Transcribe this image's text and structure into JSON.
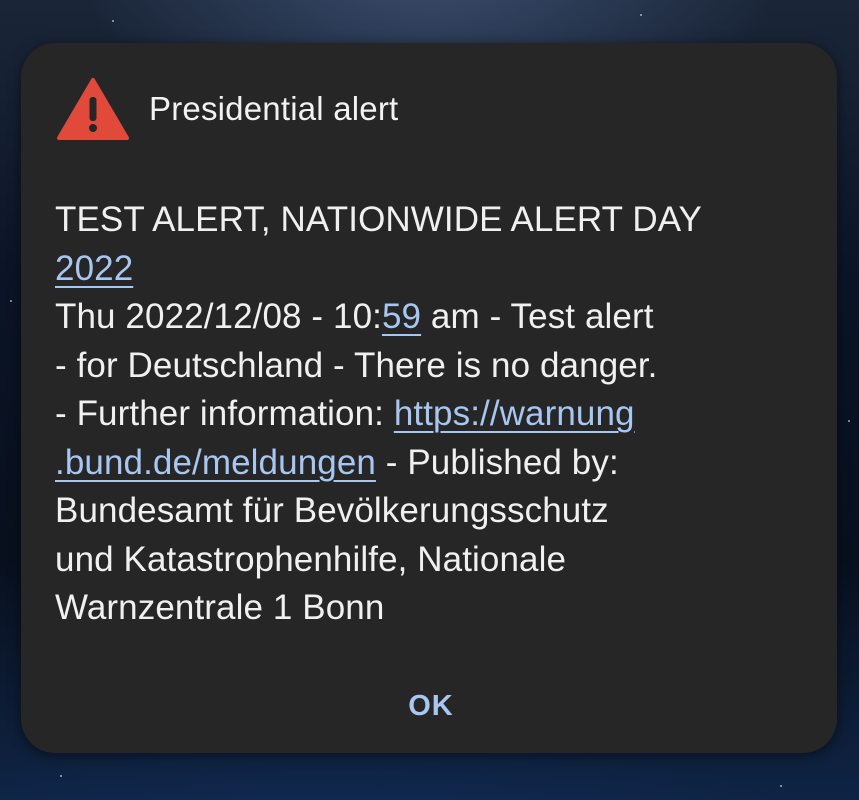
{
  "dialog": {
    "title": "Presidential alert",
    "icon": "warning-triangle-icon",
    "icon_color": "#e14a3b",
    "message": {
      "line1": "TEST ALERT, NATIONWIDE ALERT DAY",
      "line2_link": "2022",
      "line3_a": "Thu 2022/12/08 - 10:",
      "line3_link": "59",
      "line3_b": " am - Test alert",
      "line4": "- for Deutschland - There is no danger.",
      "line5_a": "- Further information: ",
      "line5_link": "https://warnung",
      "line6_link": ".bund.de/meldungen",
      "line6_b": " - Published by:",
      "line7": "Bundesamt für Bevölkerungsschutz",
      "line8": "und Katastrophenhilfe, Nationale",
      "line9": "Warnzentrale 1 Bonn"
    },
    "ok_label": "OK",
    "link_color": "#a7c7f2",
    "background_color": "#262626"
  }
}
